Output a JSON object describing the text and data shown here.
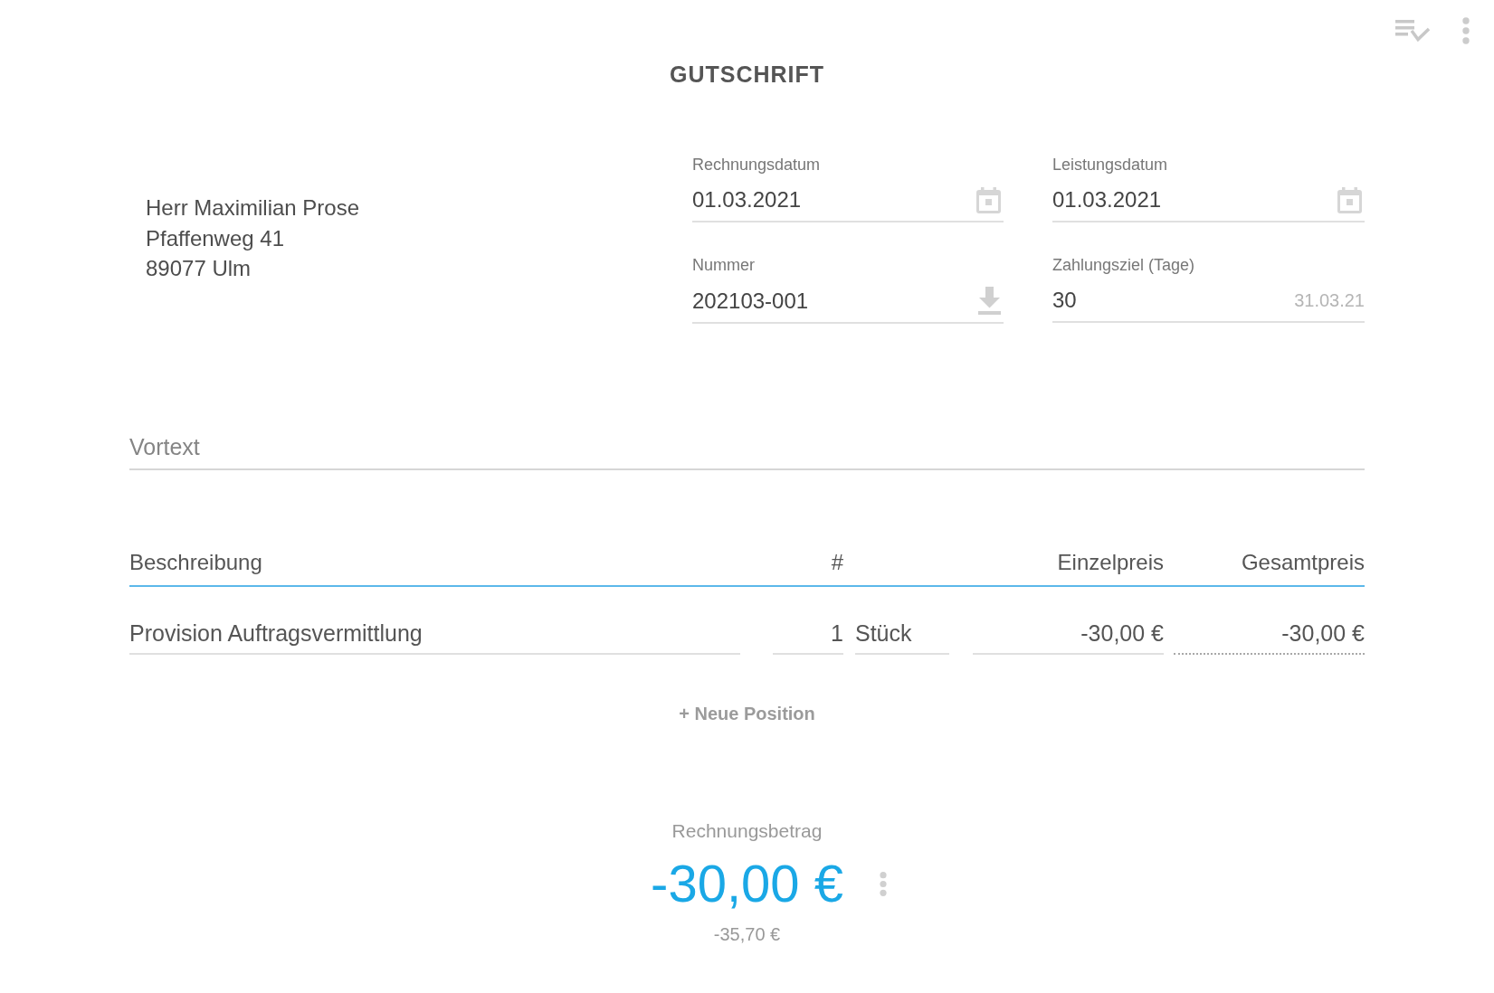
{
  "title": "GUTSCHRIFT",
  "recipient": {
    "lines": [
      "Herr Maximilian Prose",
      "Pfaffenweg 41",
      "89077 Ulm"
    ]
  },
  "fields": [
    {
      "kind": "date",
      "label": "Rechnungsdatum",
      "value": "01.03.2021"
    },
    {
      "kind": "date",
      "label": "Leistungsdatum",
      "value": "01.03.2021"
    },
    {
      "kind": "number",
      "label": "Nummer",
      "value": "202103-001"
    },
    {
      "kind": "days",
      "label": "Zahlungsziel (Tage)",
      "value": "30",
      "hint": "31.03.21"
    }
  ],
  "intro_text": {
    "placeholder": "Vortext"
  },
  "table": {
    "columns": [
      "Beschreibung",
      "#",
      "Einzelpreis",
      "Gesamtpreis"
    ],
    "rows": [
      {
        "description": "Provision Auftragsvermittlung",
        "quantity": "1",
        "unit": "Stück",
        "unit_price": "-30,00 €",
        "total": "-30,00 €"
      }
    ]
  },
  "add_button": "+ Neue Position",
  "total": {
    "label": "Rechnungsbetrag",
    "amount": "-30,00 €",
    "gross": "-35,70 €"
  }
}
